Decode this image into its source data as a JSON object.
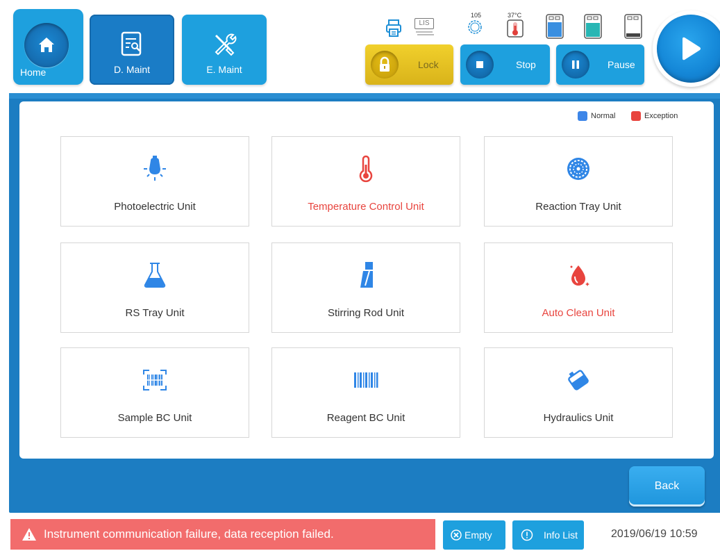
{
  "nav": {
    "home_label": "Home",
    "dmaint_label": "D. Maint",
    "emaint_label": "E. Maint"
  },
  "status": {
    "lis_label": "LIS",
    "count_value": "105",
    "temp_value": "37°C"
  },
  "controls": {
    "lock_label": "Lock",
    "stop_label": "Stop",
    "pause_label": "Pause"
  },
  "legend": {
    "normal_label": "Normal",
    "exception_label": "Exception",
    "normal_color": "#3d86e8",
    "exception_color": "#e8443e"
  },
  "units": [
    {
      "name": "Photoelectric Unit",
      "icon": "lamp-icon",
      "state": "normal"
    },
    {
      "name": "Temperature Control Unit",
      "icon": "thermometer-icon",
      "state": "exception"
    },
    {
      "name": "Reaction Tray Unit",
      "icon": "reaction-tray-icon",
      "state": "normal"
    },
    {
      "name": "RS Tray Unit",
      "icon": "flask-icon",
      "state": "normal"
    },
    {
      "name": "Stirring Rod Unit",
      "icon": "stirring-rod-icon",
      "state": "normal"
    },
    {
      "name": "Auto Clean Unit",
      "icon": "droplet-icon",
      "state": "exception"
    },
    {
      "name": "Sample BC Unit",
      "icon": "barcode-scan-icon",
      "state": "normal"
    },
    {
      "name": "Reagent BC Unit",
      "icon": "barcode-icon",
      "state": "normal"
    },
    {
      "name": "Hydraulics Unit",
      "icon": "liquid-container-icon",
      "state": "normal"
    }
  ],
  "back_label": "Back",
  "footer": {
    "alarm_text": "Instrument communication failure, data reception failed.",
    "empty_label": "Empty",
    "info_label": "Info List",
    "datetime": "2019/06/19 10:59"
  },
  "colors": {
    "accent": "#1ea0de",
    "panel": "#1c7dc2",
    "alarm": "#f26c6c",
    "lock": "#e5c224"
  }
}
